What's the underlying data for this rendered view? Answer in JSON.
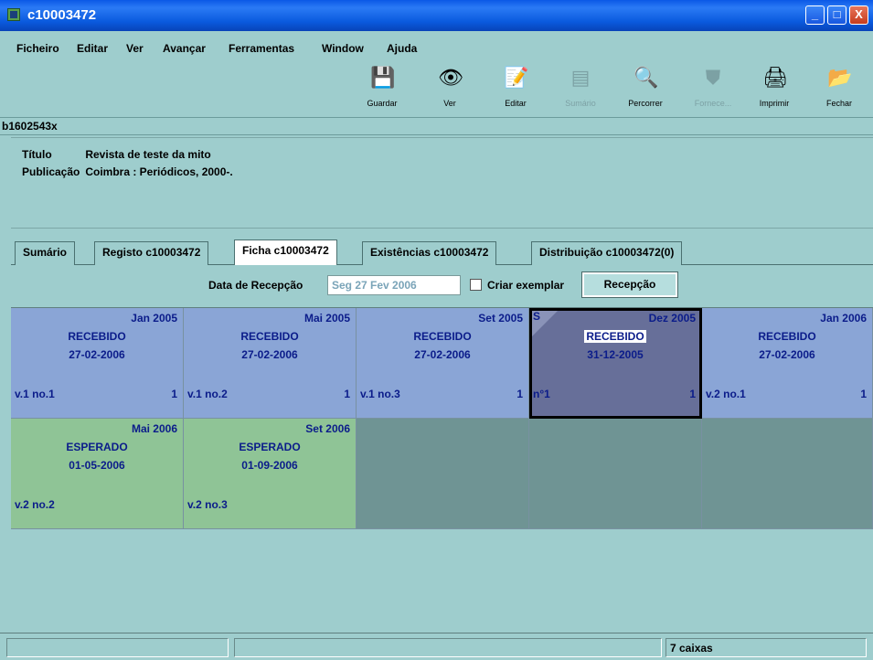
{
  "window": {
    "title": "c10003472",
    "controls": [
      "_",
      "□",
      "X"
    ]
  },
  "menu": [
    "Ficheiro",
    "Editar",
    "Ver",
    "Avançar",
    "Ferramentas",
    "Window",
    "Ajuda"
  ],
  "toolbar": [
    {
      "label": "Guardar",
      "icon": "save-icon",
      "glyph": "💾",
      "disabled": false
    },
    {
      "label": "Ver",
      "icon": "view-icon",
      "glyph": "👁",
      "disabled": false
    },
    {
      "label": "Editar",
      "icon": "edit-icon",
      "glyph": "📝",
      "disabled": false
    },
    {
      "label": "Sumário",
      "icon": "summary-icon",
      "glyph": "▤",
      "disabled": true
    },
    {
      "label": "Percorrer",
      "icon": "search-icon",
      "glyph": "🔍",
      "disabled": false
    },
    {
      "label": "Fornece...",
      "icon": "supplier-icon",
      "glyph": "⛊",
      "disabled": true
    },
    {
      "label": "Imprimir",
      "icon": "print-icon",
      "glyph": "🖨",
      "disabled": false
    },
    {
      "label": "Fechar",
      "icon": "close-folder-icon",
      "glyph": "📂",
      "disabled": false
    }
  ],
  "record_id": "b1602543x",
  "bib": {
    "titulo_label": "Título",
    "titulo": "Revista de teste da mito",
    "publicacao_label": "Publicação",
    "publicacao": "Coimbra : Periódicos, 2000-."
  },
  "tabs": [
    {
      "label": "Sumário",
      "active": false
    },
    {
      "label": "Registo c10003472",
      "active": false
    },
    {
      "label": "Ficha c10003472",
      "active": true
    },
    {
      "label": "Existências c10003472",
      "active": false
    },
    {
      "label": "Distribuição c10003472(0)",
      "active": false
    }
  ],
  "reception": {
    "date_label": "Data de Recepção",
    "date_value": "Seg 27 Fev 2006",
    "checkbox_label": "Criar exemplar",
    "checkbox_checked": false,
    "button_label": "Recepção"
  },
  "cells": [
    {
      "date": "Jan 2005",
      "status": "RECEBIDO",
      "day": "27-02-2006",
      "vol": "v.1 no.1",
      "count": "1",
      "state": "recv"
    },
    {
      "date": "Mai 2005",
      "status": "RECEBIDO",
      "day": "27-02-2006",
      "vol": "v.1 no.2",
      "count": "1",
      "state": "recv"
    },
    {
      "date": "Set 2005",
      "status": "RECEBIDO",
      "day": "27-02-2006",
      "vol": "v.1 no.3",
      "count": "1",
      "state": "recv"
    },
    {
      "date": "Dez 2005",
      "status": "RECEBIDO",
      "day": "31-12-2005",
      "vol": "n°1",
      "count": "1",
      "state": "sel",
      "flag": "S"
    },
    {
      "date": "Jan 2006",
      "status": "RECEBIDO",
      "day": "27-02-2006",
      "vol": "v.2 no.1",
      "count": "1",
      "state": "recv"
    },
    {
      "date": "Mai 2006",
      "status": "ESPERADO",
      "day": "01-05-2006",
      "vol": "v.2 no.2",
      "count": "",
      "state": "exp"
    },
    {
      "date": "Set 2006",
      "status": "ESPERADO",
      "day": "01-09-2006",
      "vol": "v.2 no.3",
      "count": "",
      "state": "exp"
    }
  ],
  "status": {
    "count_text": "7 caixas"
  },
  "colors": {
    "background": "#9ecdcd",
    "received": "#8aa5d6",
    "expected": "#8fc496",
    "selected": "#676f99",
    "text": "#0b1c8a"
  }
}
